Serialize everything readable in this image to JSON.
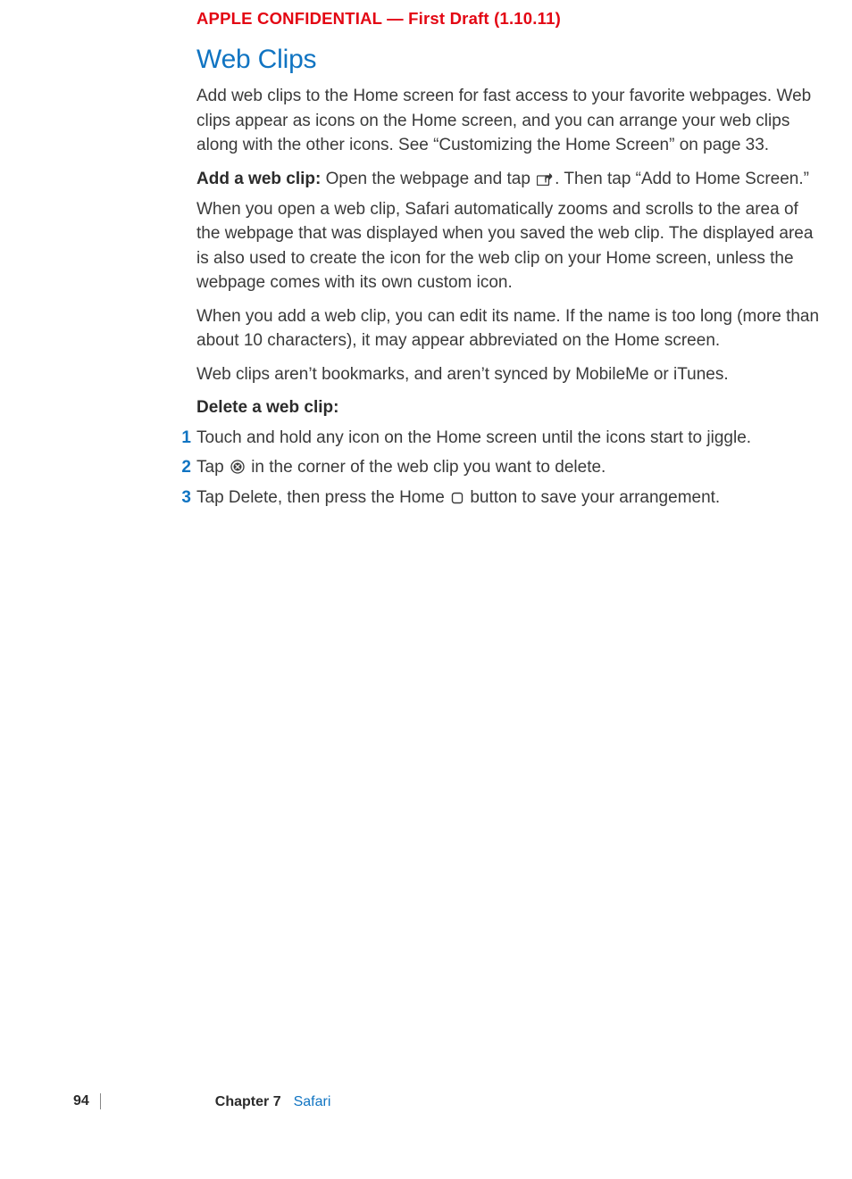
{
  "header": {
    "confidential": "APPLE CONFIDENTIAL — First Draft (1.10.11)"
  },
  "section": {
    "title": "Web Clips",
    "intro": "Add web clips to the Home screen for fast access to your favorite webpages. Web clips appear as icons on the Home screen, and you can arrange your web clips along with the other icons. See “Customizing the Home Screen” on page 33.",
    "add_label": "Add a web clip:",
    "add_instruction_before": "  Open the webpage and tap ",
    "add_instruction_after": ". Then tap “Add to Home Screen.”",
    "para2": "When you open a web clip, Safari automatically zooms and scrolls to the area of the webpage that was displayed when you saved the web clip. The displayed area is also used to create the icon for the web clip on your Home screen, unless the webpage comes with its own custom icon.",
    "para3": "When you add a web clip, you can edit its name. If the name is too long (more than about 10 characters), it may appear abbreviated on the Home screen.",
    "para4": "Web clips aren’t bookmarks, and aren’t synced by MobileMe or iTunes.",
    "delete_heading": "Delete a web clip:",
    "steps": [
      {
        "num": "1",
        "text": "Touch and hold any icon on the Home screen until the icons start to jiggle."
      },
      {
        "num": "2",
        "text_before": "Tap ",
        "text_after": " in the corner of the web clip you want to delete."
      },
      {
        "num": "3",
        "text_before": "Tap Delete, then press the Home ",
        "text_after": " button to save your arrangement."
      }
    ]
  },
  "footer": {
    "page": "94",
    "chapter_label": "Chapter 7",
    "chapter_name": "Safari"
  }
}
